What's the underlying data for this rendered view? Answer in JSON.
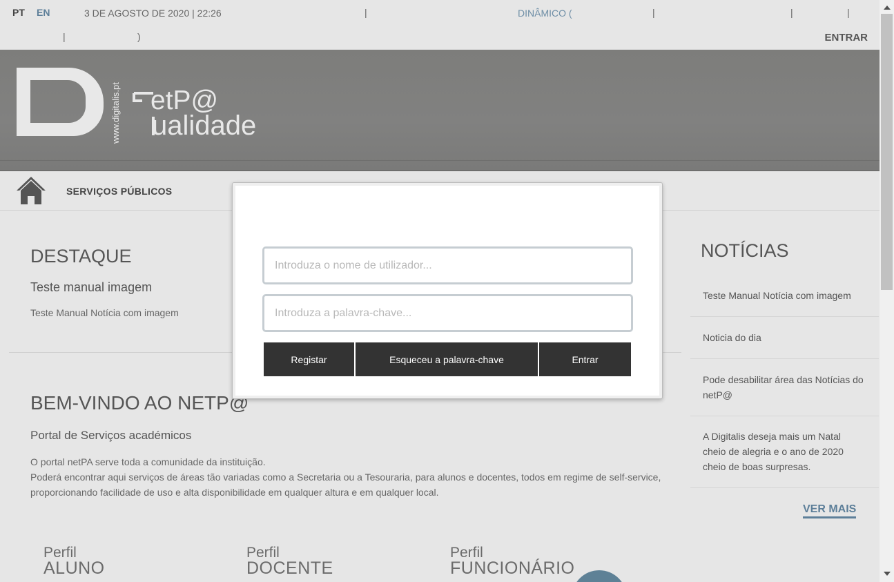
{
  "topbar": {
    "lang_pt": "PT",
    "lang_en": "EN",
    "datetime": "3 DE AGOSTO DE 2020 | 22:26",
    "separator": "|",
    "dinamico": "DINÂMICO (",
    "close_paren": ")",
    "login": "ENTRAR"
  },
  "banner": {
    "logo_side_text": "www.digitalis.pt",
    "logo_line1": "etP@",
    "logo_line2": "ualidade"
  },
  "nav": {
    "services": "SERVIÇOS PÚBLICOS"
  },
  "destaque": {
    "title": "DESTAQUE",
    "subtitle": "Teste manual imagem",
    "text": "Teste Manual Notícia com imagem"
  },
  "welcome": {
    "title": "BEM-VINDO AO NETP@",
    "subtitle": "Portal de Serviços académicos",
    "p1": "O portal netPA serve toda a comunidade da instituição.",
    "p2": "Poderá encontrar aqui serviços de áreas tão variadas como a Secretaria ou a Tesouraria, para alunos e docentes, todos em regime de self-service, proporcionando facilidade de uso e alta disponibilidade em qualquer altura e em qualquer local."
  },
  "profiles": [
    {
      "small": "Perfil",
      "big": "ALUNO"
    },
    {
      "small": "Perfil",
      "big": "DOCENTE"
    },
    {
      "small": "Perfil",
      "big": "FUNCIONÁRIO"
    }
  ],
  "news": {
    "title": "NOTÍCIAS",
    "items": [
      "Teste Manual Notícia com imagem",
      "Noticia do dia",
      "Pode desabilitar área das Notícias do netP@",
      "A Digitalis deseja mais um Natal cheio de alegria e o ano de 2020 cheio de boas surpresas."
    ],
    "more": "VER MAIS"
  },
  "login_modal": {
    "username_placeholder": "Introduza o nome de utilizador...",
    "password_placeholder": "Introduza a palavra-chave...",
    "register": "Registar",
    "forgot": "Esqueceu a palavra-chave",
    "submit": "Entrar"
  },
  "colors": {
    "accent": "#5d7f99",
    "banner": "#808080",
    "button": "#333333",
    "page_bg": "#e6e6e6"
  }
}
